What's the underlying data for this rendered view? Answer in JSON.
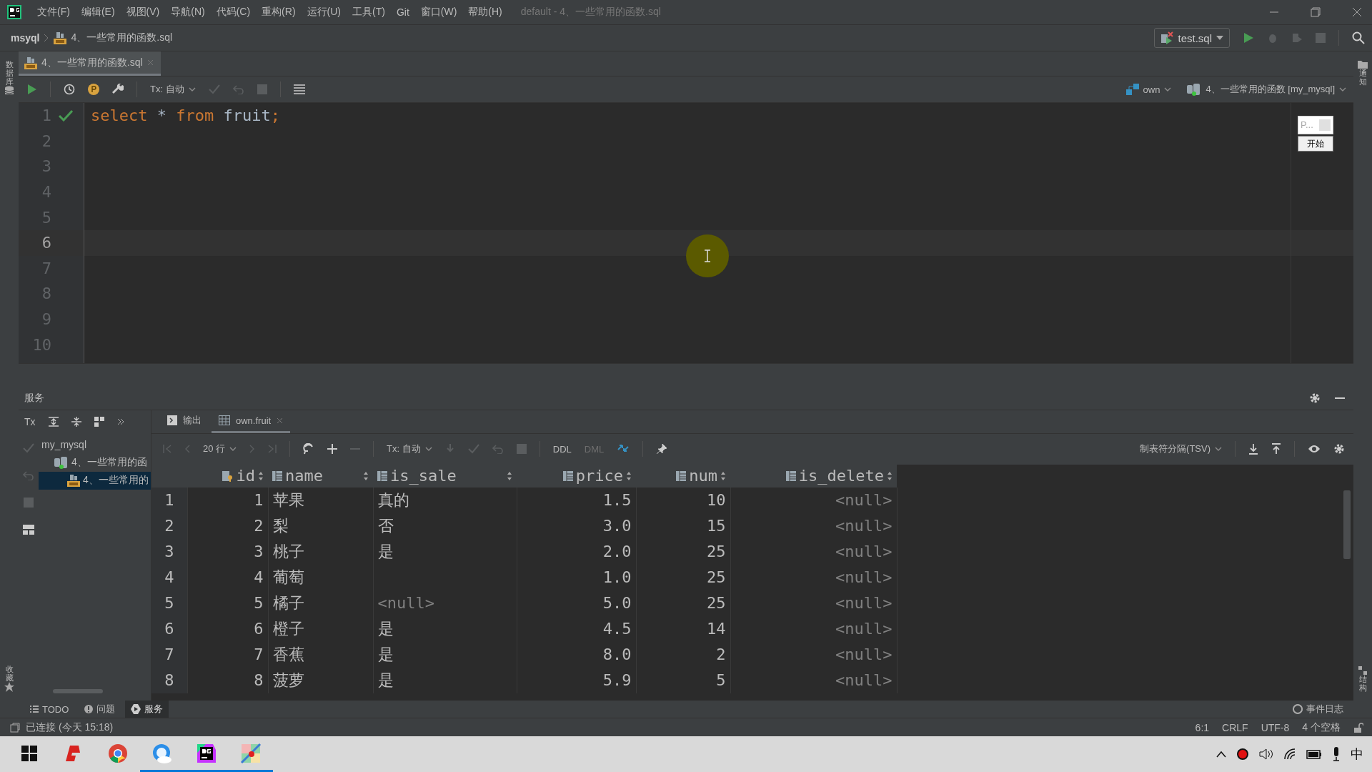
{
  "window": {
    "title": "default - 4、一些常用的函数.sql"
  },
  "menu": [
    "文件(F)",
    "编辑(E)",
    "视图(V)",
    "导航(N)",
    "代码(C)",
    "重构(R)",
    "运行(U)",
    "工具(T)",
    "Git",
    "窗口(W)",
    "帮助(H)"
  ],
  "breadcrumb": {
    "project": "msyql",
    "file": "4、一些常用的函数.sql"
  },
  "run_config": {
    "label": "test.sql"
  },
  "side_labels": {
    "left_top": "数据库",
    "left_bottom": "收藏",
    "right_top": "通知",
    "right_bottom": "结构"
  },
  "editor_tabs": [
    {
      "label": "4、一些常用的函数.sql",
      "selected": true
    }
  ],
  "editor_toolbar": {
    "tx": "Tx: 自动",
    "schema": "own",
    "session": "4、一些常用的函数 [my_mysql]"
  },
  "editor": {
    "lines": [
      {
        "number": "1",
        "current": false,
        "ok": true,
        "tokens": [
          {
            "text": "select",
            "kind": "keyword"
          },
          {
            "text": " * ",
            "kind": "operator"
          },
          {
            "text": "from",
            "kind": "keyword"
          },
          {
            "text": " fruit",
            "kind": "identifier"
          },
          {
            "text": ";",
            "kind": "keyword"
          }
        ]
      },
      {
        "number": "2",
        "current": false,
        "ok": false
      },
      {
        "number": "3",
        "current": false,
        "ok": false
      },
      {
        "number": "4",
        "current": false,
        "ok": false
      },
      {
        "number": "5",
        "current": false,
        "ok": false
      },
      {
        "number": "6",
        "current": true,
        "ok": false
      },
      {
        "number": "7",
        "current": false,
        "ok": false
      },
      {
        "number": "8",
        "current": false,
        "ok": false
      },
      {
        "number": "9",
        "current": false,
        "ok": false
      },
      {
        "number": "10",
        "current": false,
        "ok": false
      }
    ]
  },
  "overlay": {
    "field": "P...",
    "button": "开始"
  },
  "services": {
    "title": "服务",
    "tx": "Tx",
    "tree": [
      {
        "label": "my_mysql",
        "selected": false,
        "children": [
          {
            "label": "4、一些常用的函",
            "selected": false,
            "children": [
              {
                "label": "4、一些常用的",
                "selected": true
              }
            ]
          }
        ]
      }
    ]
  },
  "result_tabs": [
    {
      "label": "输出",
      "kind": "console",
      "selected": false
    },
    {
      "label": "own.fruit",
      "kind": "table",
      "selected": true
    }
  ],
  "result_toolbar": {
    "page_size": "20 行",
    "tx": "Tx: 自动",
    "modes": [
      {
        "label": "DDL",
        "disabled": false
      },
      {
        "label": "DML",
        "disabled": true
      }
    ],
    "format": "制表符分隔(TSV)"
  },
  "table": {
    "columns": [
      {
        "name": "id",
        "key": true,
        "numeric": true
      },
      {
        "name": "name",
        "key": false,
        "numeric": false
      },
      {
        "name": "is_sale",
        "key": false,
        "numeric": false
      },
      {
        "name": "price",
        "key": false,
        "numeric": true
      },
      {
        "name": "num",
        "key": false,
        "numeric": true
      },
      {
        "name": "is_delete",
        "key": false,
        "numeric": true
      }
    ],
    "rows": [
      {
        "number": "1",
        "cells": [
          {
            "text": "1",
            "kind": "value"
          },
          {
            "text": "苹果",
            "kind": "value"
          },
          {
            "text": "真的",
            "kind": "value"
          },
          {
            "text": "1.5",
            "kind": "value"
          },
          {
            "text": "10",
            "kind": "value"
          },
          {
            "text": "<null>",
            "kind": "null"
          }
        ]
      },
      {
        "number": "2",
        "cells": [
          {
            "text": "2",
            "kind": "value"
          },
          {
            "text": "梨",
            "kind": "value"
          },
          {
            "text": "否",
            "kind": "value"
          },
          {
            "text": "3.0",
            "kind": "value"
          },
          {
            "text": "15",
            "kind": "value"
          },
          {
            "text": "<null>",
            "kind": "null"
          }
        ]
      },
      {
        "number": "3",
        "cells": [
          {
            "text": "3",
            "kind": "value"
          },
          {
            "text": "桃子",
            "kind": "value"
          },
          {
            "text": "是",
            "kind": "value"
          },
          {
            "text": "2.0",
            "kind": "value"
          },
          {
            "text": "25",
            "kind": "value"
          },
          {
            "text": "<null>",
            "kind": "null"
          }
        ]
      },
      {
        "number": "4",
        "cells": [
          {
            "text": "4",
            "kind": "value"
          },
          {
            "text": "葡萄",
            "kind": "value"
          },
          {
            "kind": "empty"
          },
          {
            "text": "1.0",
            "kind": "value"
          },
          {
            "text": "25",
            "kind": "value"
          },
          {
            "text": "<null>",
            "kind": "null"
          }
        ]
      },
      {
        "number": "5",
        "cells": [
          {
            "text": "5",
            "kind": "value"
          },
          {
            "text": "橘子",
            "kind": "value"
          },
          {
            "text": "<null>",
            "kind": "null"
          },
          {
            "text": "5.0",
            "kind": "value"
          },
          {
            "text": "25",
            "kind": "value"
          },
          {
            "text": "<null>",
            "kind": "null"
          }
        ]
      },
      {
        "number": "6",
        "cells": [
          {
            "text": "6",
            "kind": "value"
          },
          {
            "text": "橙子",
            "kind": "value"
          },
          {
            "text": "是",
            "kind": "value"
          },
          {
            "text": "4.5",
            "kind": "value"
          },
          {
            "text": "14",
            "kind": "value"
          },
          {
            "text": "<null>",
            "kind": "null"
          }
        ]
      },
      {
        "number": "7",
        "cells": [
          {
            "text": "7",
            "kind": "value"
          },
          {
            "text": "香蕉",
            "kind": "value"
          },
          {
            "text": "是",
            "kind": "value"
          },
          {
            "text": "8.0",
            "kind": "value"
          },
          {
            "text": "2",
            "kind": "value"
          },
          {
            "text": "<null>",
            "kind": "null"
          }
        ]
      },
      {
        "number": "8",
        "cells": [
          {
            "text": "8",
            "kind": "value"
          },
          {
            "text": "菠萝",
            "kind": "value"
          },
          {
            "text": "是",
            "kind": "value"
          },
          {
            "text": "5.9",
            "kind": "value"
          },
          {
            "text": "5",
            "kind": "value"
          },
          {
            "text": "<null>",
            "kind": "null"
          }
        ]
      }
    ]
  },
  "bottom_tabs": [
    {
      "label": "TODO",
      "kind": "todo",
      "selected": false
    },
    {
      "label": "问题",
      "kind": "problems",
      "selected": false
    },
    {
      "label": "服务",
      "kind": "services",
      "selected": true
    }
  ],
  "event_log": "事件日志",
  "status": {
    "connection": "已连接 (今天 15:18)",
    "items": [
      "6:1",
      "CRLF",
      "UTF-8",
      "4 个空格"
    ]
  },
  "taskbar": {
    "apps": [
      {
        "kind": "start",
        "running": false
      },
      {
        "kind": "app",
        "running": false
      },
      {
        "kind": "browser",
        "running": false
      },
      {
        "kind": "cloud",
        "running": true
      },
      {
        "kind": "datagrip",
        "running": true
      },
      {
        "kind": "paint",
        "running": true
      }
    ],
    "ime": "中"
  }
}
